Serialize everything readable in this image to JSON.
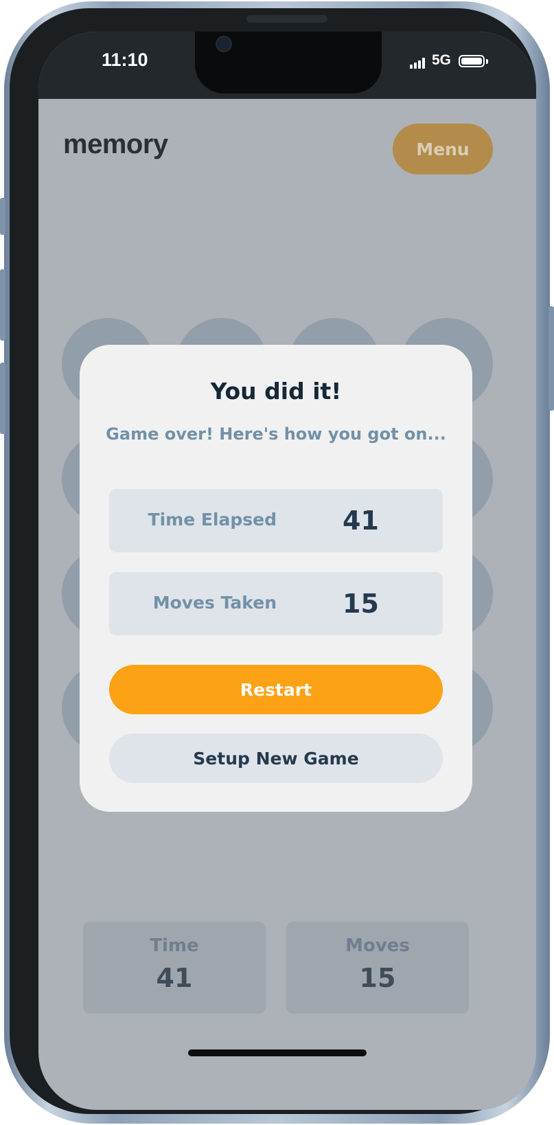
{
  "status_bar": {
    "time": "11:10",
    "network": "5G",
    "signal_icon": "signal-bars-icon",
    "battery_icon": "battery-icon"
  },
  "header": {
    "logo": "memory",
    "menu_label": "Menu"
  },
  "board": {
    "tile_icon": "memory-tile",
    "colors": {
      "tile": "#929ea9",
      "background": "#adb1b8"
    }
  },
  "stats": {
    "time_label": "Time",
    "time_value": "41",
    "moves_label": "Moves",
    "moves_value": "15"
  },
  "modal": {
    "title": "You did it!",
    "subtitle": "Game over! Here's how you got on...",
    "results": [
      {
        "label": "Time Elapsed",
        "value": "41"
      },
      {
        "label": "Moves Taken",
        "value": "15"
      }
    ],
    "restart_label": "Restart",
    "setup_label": "Setup New Game"
  },
  "colors": {
    "accent": "#fda214",
    "dark_text": "#152738",
    "muted_text": "#7191a8",
    "light_surface": "#dfe4ea"
  }
}
